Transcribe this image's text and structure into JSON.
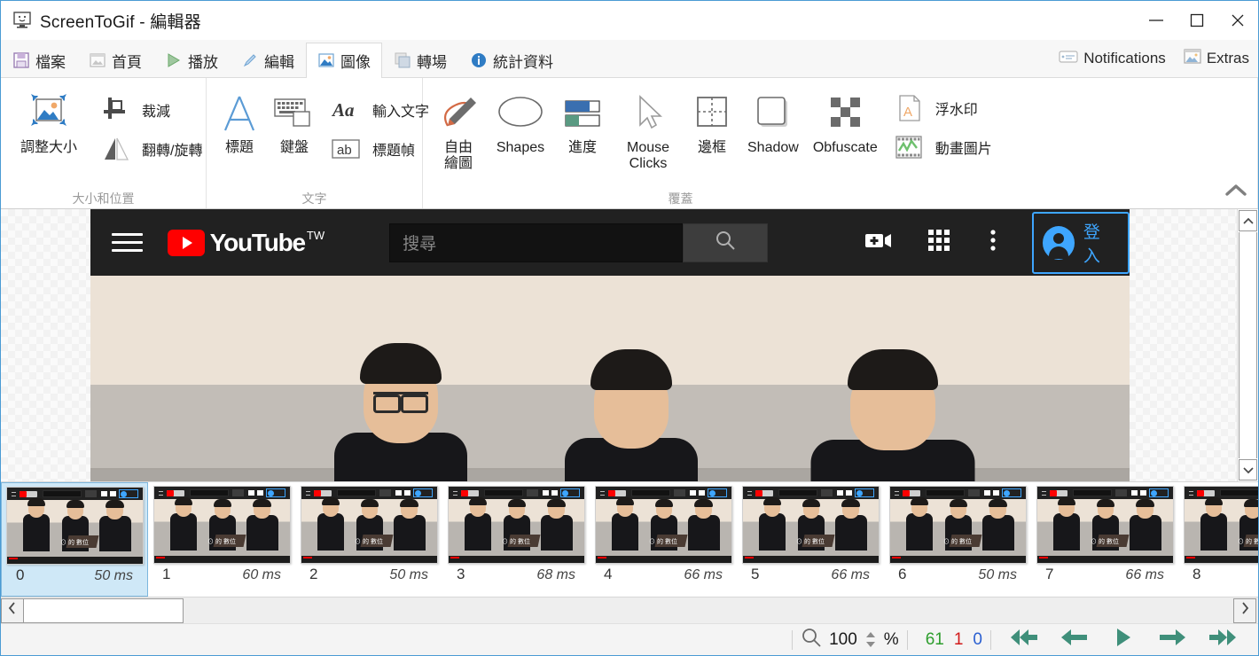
{
  "window": {
    "title": "ScreenToGif - 編輯器",
    "app_icon": "monitor-icon",
    "minimize": "—",
    "maximize": "□",
    "close": "✕"
  },
  "ribbon": {
    "tabs": [
      {
        "label": "檔案",
        "icon": "save-icon",
        "active": false
      },
      {
        "label": "首頁",
        "icon": "home-image-icon",
        "active": false
      },
      {
        "label": "播放",
        "icon": "play-icon",
        "active": false
      },
      {
        "label": "編輯",
        "icon": "pencil-icon",
        "active": false
      },
      {
        "label": "圖像",
        "icon": "image-icon",
        "active": true
      },
      {
        "label": "轉場",
        "icon": "transition-icon",
        "active": false
      },
      {
        "label": "統計資料",
        "icon": "info-icon",
        "active": false
      }
    ],
    "right_items": [
      {
        "label": "Notifications",
        "icon": "notification-icon"
      },
      {
        "label": "Extras",
        "icon": "extras-image-icon"
      }
    ],
    "groups": [
      {
        "title": "大小和位置",
        "big": [
          {
            "label": "調整大小",
            "icon": "resize-icon"
          }
        ],
        "small": [
          {
            "label": "裁減",
            "icon": "crop-icon"
          },
          {
            "label": "翻轉/旋轉",
            "icon": "flip-rotate-icon"
          }
        ]
      },
      {
        "title": "文字",
        "big": [
          {
            "label": "標題",
            "icon": "caption-a-icon"
          },
          {
            "label": "鍵盤",
            "icon": "keyboard-icon"
          }
        ],
        "small": [
          {
            "label": "輸入文字",
            "icon": "free-text-icon"
          },
          {
            "label": "標題幀",
            "icon": "title-frame-icon"
          }
        ]
      },
      {
        "title": "覆蓋",
        "big": [
          {
            "label": "自由\n繪圖",
            "icon": "free-draw-icon"
          },
          {
            "label": "Shapes",
            "icon": "shapes-ellipse-icon"
          },
          {
            "label": "進度",
            "icon": "progress-icon"
          },
          {
            "label": "Mouse\nClicks",
            "icon": "mouse-cursor-icon"
          },
          {
            "label": "邊框",
            "icon": "border-icon"
          },
          {
            "label": "Shadow",
            "icon": "shadow-icon"
          },
          {
            "label": "Obfuscate",
            "icon": "obfuscate-icon"
          }
        ],
        "small": [
          {
            "label": "浮水印",
            "icon": "watermark-icon"
          },
          {
            "label": "動畫圖片",
            "icon": "cinemagraph-icon"
          }
        ]
      }
    ],
    "collapse_icon": "chevron-up-icon"
  },
  "preview": {
    "youtube": {
      "menu_icon": "hamburger-icon",
      "logo_text": "YouTube",
      "region_code": "TW",
      "search_placeholder": "搜尋",
      "search_icon": "search-icon",
      "create_icon": "create-video-icon",
      "apps_icon": "apps-grid-icon",
      "more_icon": "more-vertical-icon",
      "signin_label": "登入",
      "signin_icon": "account-circle-icon",
      "signin_accent": "#3ea6ff"
    },
    "scroll": {
      "inner_up_icon": "caret-up-icon",
      "outer_up_icon": "chevron-up-icon",
      "outer_down_icon": "chevron-down-icon"
    }
  },
  "filmstrip": {
    "frames": [
      {
        "index": "0",
        "duration": "50 ms",
        "selected": true
      },
      {
        "index": "1",
        "duration": "60 ms",
        "selected": false
      },
      {
        "index": "2",
        "duration": "50 ms",
        "selected": false
      },
      {
        "index": "3",
        "duration": "68 ms",
        "selected": false
      },
      {
        "index": "4",
        "duration": "66 ms",
        "selected": false
      },
      {
        "index": "5",
        "duration": "66 ms",
        "selected": false
      },
      {
        "index": "6",
        "duration": "50 ms",
        "selected": false
      },
      {
        "index": "7",
        "duration": "66 ms",
        "selected": false
      },
      {
        "index": "8",
        "duration": "",
        "selected": false
      }
    ],
    "thumb_caption": "⊙ 的 數位"
  },
  "hscroll": {
    "left_icon": "chevron-left-icon",
    "right_icon": "chevron-right-icon"
  },
  "statusbar": {
    "zoom_icon": "magnifier-icon",
    "zoom_value": "100",
    "spinner_icon": "spinner-up-down-icon",
    "percent": "%",
    "total_frames": "61",
    "current_frame": "1",
    "selected_count": "0",
    "colors": {
      "total": "#2e9e2e",
      "current": "#d11a1a",
      "selected": "#2a5fd1",
      "nav": "#3f8f7a"
    },
    "nav": [
      {
        "name": "first-frame",
        "icon": "skip-first-icon"
      },
      {
        "name": "previous-frame",
        "icon": "arrow-left-icon"
      },
      {
        "name": "play",
        "icon": "play-triangle-icon"
      },
      {
        "name": "next-frame",
        "icon": "arrow-right-icon"
      },
      {
        "name": "last-frame",
        "icon": "skip-last-icon"
      }
    ]
  }
}
